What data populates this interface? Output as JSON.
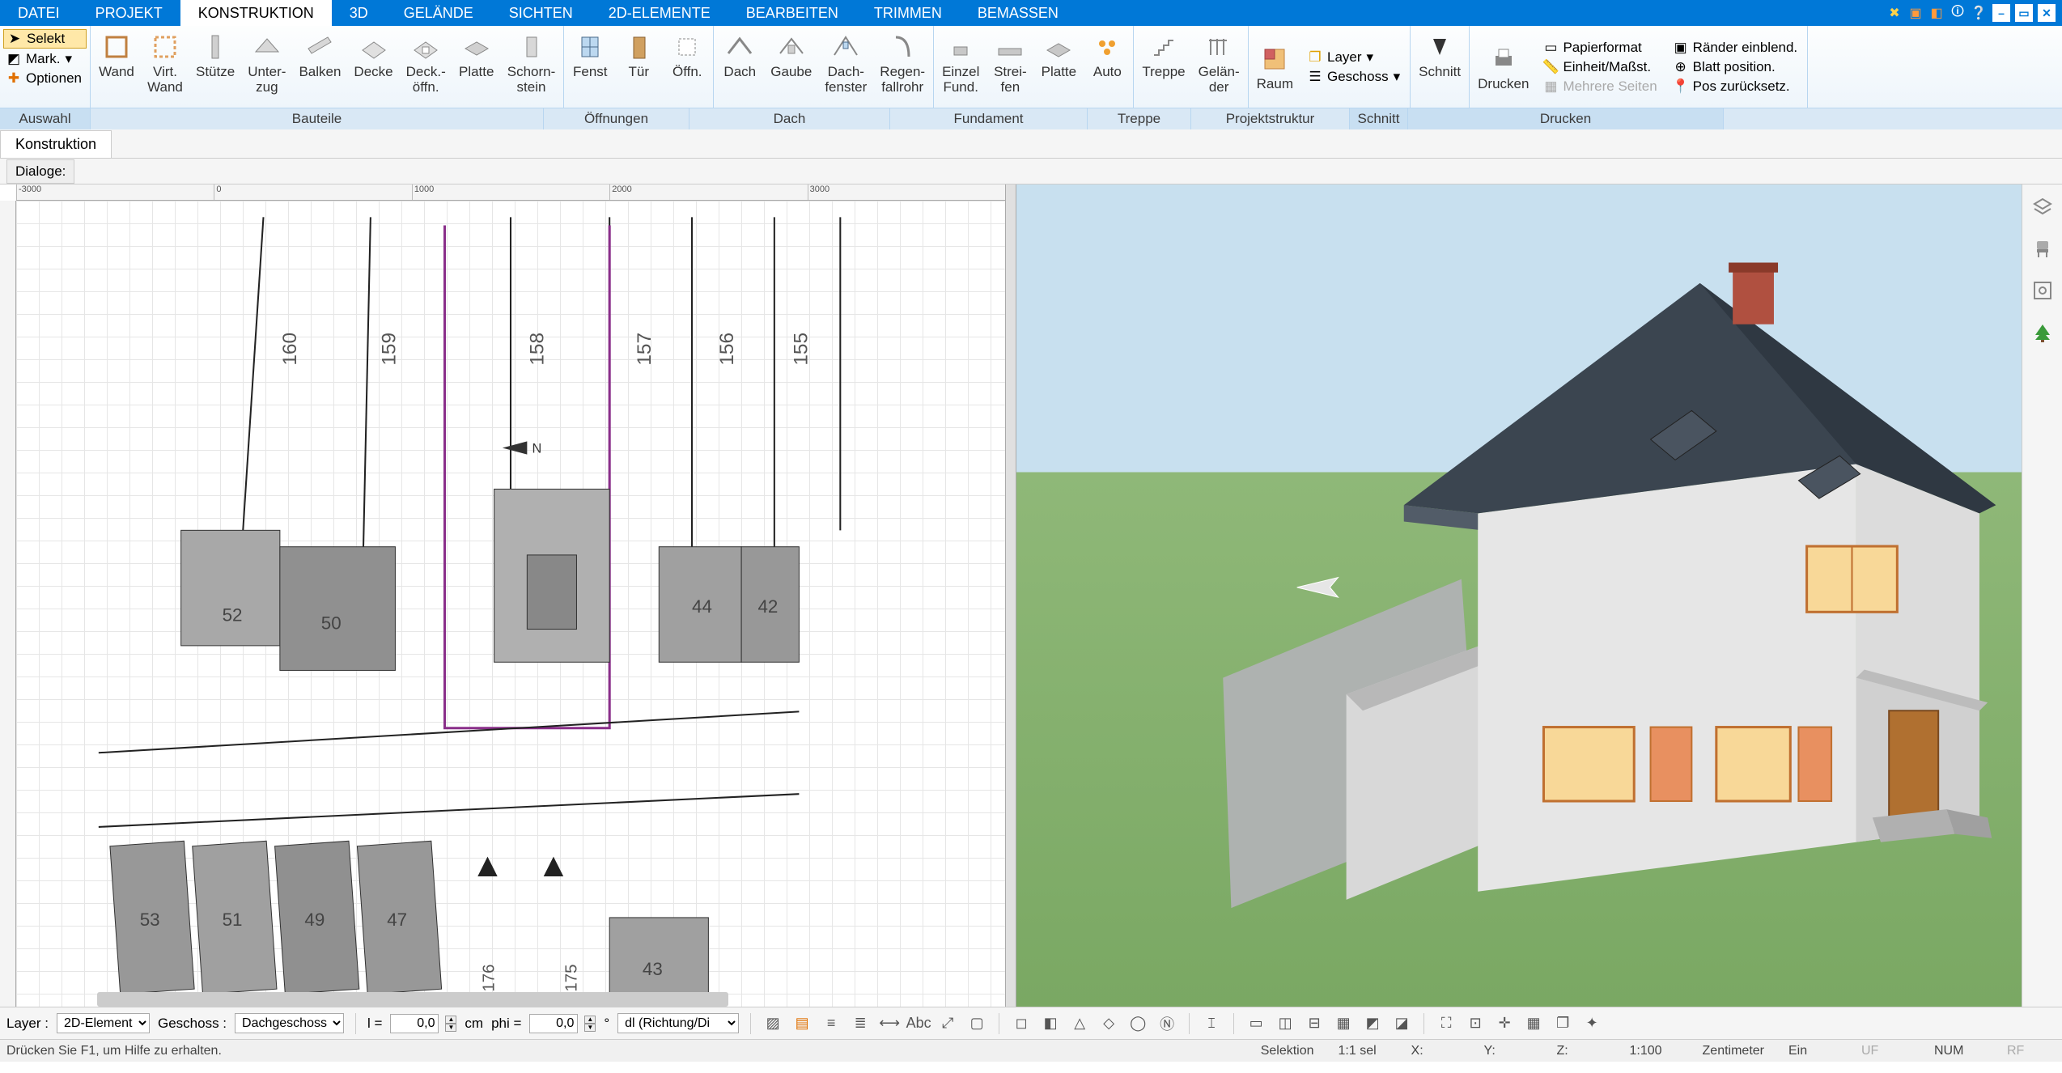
{
  "menubar": {
    "items": [
      "DATEI",
      "PROJEKT",
      "KONSTRUKTION",
      "3D",
      "GELÄNDE",
      "SICHTEN",
      "2D-ELEMENTE",
      "BEARBEITEN",
      "TRIMMEN",
      "BEMASSEN"
    ],
    "active_index": 2
  },
  "ribbon": {
    "auswahl": {
      "selekt": "Selekt",
      "mark": "Mark.",
      "optionen": "Optionen",
      "group_label": "Auswahl"
    },
    "bauteile": {
      "items": [
        {
          "label": "Wand"
        },
        {
          "label": "Virt.\nWand"
        },
        {
          "label": "Stütze"
        },
        {
          "label": "Unter-\nzug"
        },
        {
          "label": "Balken"
        },
        {
          "label": "Decke"
        },
        {
          "label": "Deck.-\nöffn."
        },
        {
          "label": "Platte"
        },
        {
          "label": "Schorn-\nstein"
        }
      ],
      "group_label": "Bauteile"
    },
    "oeffnungen": {
      "items": [
        {
          "label": "Fenst"
        },
        {
          "label": "Tür"
        },
        {
          "label": "Öffn."
        }
      ],
      "group_label": "Öffnungen"
    },
    "dach": {
      "items": [
        {
          "label": "Dach"
        },
        {
          "label": "Gaube"
        },
        {
          "label": "Dach-\nfenster"
        },
        {
          "label": "Regen-\nfallrohr"
        }
      ],
      "group_label": "Dach"
    },
    "fundament": {
      "items": [
        {
          "label": "Einzel\nFund."
        },
        {
          "label": "Strei-\nfen"
        },
        {
          "label": "Platte"
        },
        {
          "label": "Auto"
        }
      ],
      "group_label": "Fundament"
    },
    "treppe": {
      "items": [
        {
          "label": "Treppe"
        },
        {
          "label": "Gelän-\nder"
        }
      ],
      "group_label": "Treppe"
    },
    "projektstruktur": {
      "items": [
        {
          "label": "Raum"
        }
      ],
      "layer": "Layer",
      "geschoss": "Geschoss",
      "group_label": "Projektstruktur"
    },
    "schnitt": {
      "label": "Schnitt",
      "group_label": "Schnitt"
    },
    "drucken": {
      "label": "Drucken",
      "rows": [
        "Papierformat",
        "Einheit/Maßst.",
        "Mehrere Seiten"
      ],
      "rows2": [
        "Ränder einblend.",
        "Blatt position.",
        "Pos zurücksetz."
      ],
      "group_label": "Drucken"
    }
  },
  "subheader": {
    "tab": "Konstruktion"
  },
  "dialoge": {
    "label": "Dialoge:"
  },
  "plan": {
    "ruler_h": [
      "-3000",
      "0",
      "1000",
      "2000",
      "3000"
    ],
    "parcels_top": [
      "160",
      "159",
      "158",
      "157",
      "156",
      "155"
    ],
    "houses_top": [
      "52",
      "50",
      "44",
      "42"
    ],
    "parcels_bottom_left": [
      "53",
      "51",
      "49",
      "47"
    ],
    "parcels_bottom_right": [
      "176",
      "175"
    ],
    "house_bottom": "43"
  },
  "rightbar": {
    "icons": [
      "layers-icon",
      "chair-icon",
      "focus-icon",
      "tree-icon"
    ]
  },
  "bottombar": {
    "layer_label": "Layer :",
    "layer_value": "2D-Element",
    "geschoss_label": "Geschoss :",
    "geschoss_value": "Dachgeschoss",
    "l_label": "l =",
    "l_value": "0,0",
    "cm": "cm",
    "phi_label": "phi =",
    "phi_value": "0,0",
    "deg": "°",
    "dl": "dl (Richtung/Di",
    "abc": "Abc"
  },
  "statusbar": {
    "help": "Drücken Sie F1, um Hilfe zu erhalten.",
    "selektion": "Selektion",
    "sel": "1:1 sel",
    "x": "X:",
    "y": "Y:",
    "z": "Z:",
    "scale": "1:100",
    "unit": "Zentimeter",
    "ein": "Ein",
    "uf": "UF",
    "num": "NUM",
    "rf": "RF"
  }
}
